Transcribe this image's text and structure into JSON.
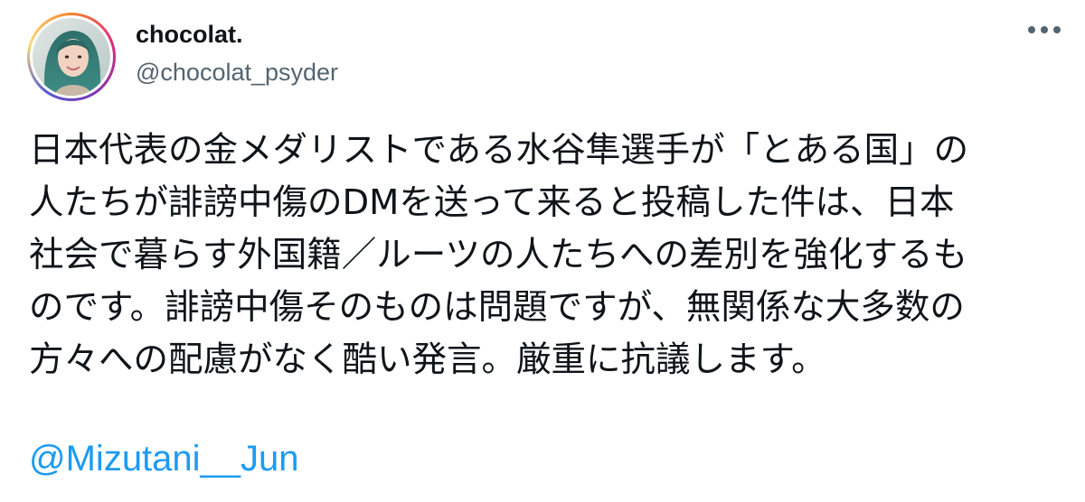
{
  "author": {
    "display_name": "chocolat.",
    "handle": "@chocolat_psyder",
    "avatar_icon": "profile-photo"
  },
  "actions": {
    "more_icon": "more-horizontal-icon"
  },
  "tweet": {
    "lines": [
      "日本代表の金メダリストである水谷隼選手が「とある国」の",
      "人たちが誹謗中傷のDMを送って来ると投稿した件は、日本",
      "社会で暮らす外国籍／ルーツの人たちへの差別を強化するも",
      "のです。誹謗中傷そのものは問題ですが、無関係な大多数の",
      "方々への配慮がなく酷い発言。厳重に抗議します。"
    ],
    "mention": "@Mizutani__Jun"
  },
  "colors": {
    "text": "#0f1419",
    "secondary": "#536471",
    "link": "#1d9bf0"
  }
}
